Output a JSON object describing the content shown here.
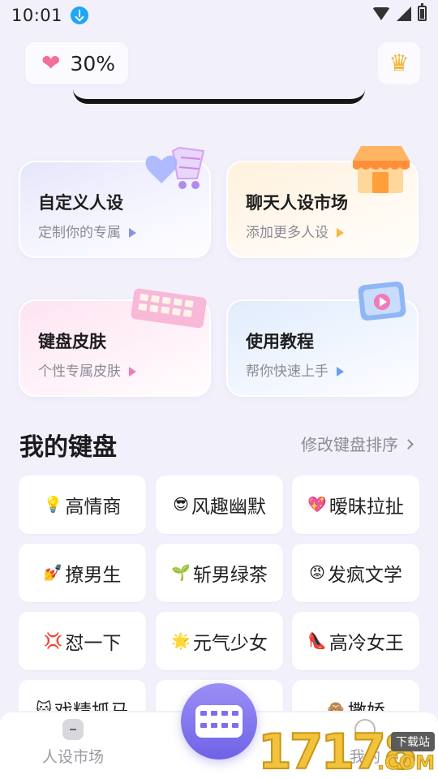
{
  "status_bar": {
    "time": "10:01",
    "icons": [
      "download-icon",
      "wifi-icon",
      "signal-icon",
      "battery-icon"
    ]
  },
  "header": {
    "energy_icon": "heart-icon",
    "energy_value": "30%",
    "vip_icon": "crown-icon"
  },
  "feature_cards": [
    {
      "title": "自定义人设",
      "subtitle": "定制你的专属",
      "icon": "cart-heart-icon",
      "arrow_color": "#8b8fe8"
    },
    {
      "title": "聊天人设市场",
      "subtitle": "添加更多人设",
      "icon": "shop-icon",
      "arrow_color": "#f5b94a"
    },
    {
      "title": "键盘皮肤",
      "subtitle": "个性专属皮肤",
      "icon": "keyboard-icon",
      "arrow_color": "#f07bb8"
    },
    {
      "title": "使用教程",
      "subtitle": "帮你快速上手",
      "icon": "video-phone-icon",
      "arrow_color": "#6a9ef0"
    }
  ],
  "my_keyboards": {
    "title": "我的键盘",
    "reorder_label": "修改键盘排序",
    "items": [
      {
        "emoji": "💡",
        "label": "高情商"
      },
      {
        "emoji": "😎",
        "label": "风趣幽默"
      },
      {
        "emoji": "💖",
        "label": "暧昧拉扯"
      },
      {
        "emoji": "💅",
        "label": "撩男生"
      },
      {
        "emoji": "🌱",
        "label": "斩男绿茶"
      },
      {
        "emoji": "😡",
        "label": "发疯文学"
      },
      {
        "emoji": "💢",
        "label": "怼一下"
      },
      {
        "emoji": "🌟",
        "label": "元气少女"
      },
      {
        "emoji": "👠",
        "label": "高冷女王"
      },
      {
        "emoji": "🐱",
        "label": "戏精抓马"
      },
      {
        "emoji": "",
        "label": ""
      },
      {
        "emoji": "🙈",
        "label": "撒娇"
      }
    ]
  },
  "bottom_nav": {
    "market_label": "人设市场",
    "mine_label": "我的"
  },
  "watermark": {
    "digits": "17178",
    "tag": "下载站",
    "suffix": ".COM"
  }
}
